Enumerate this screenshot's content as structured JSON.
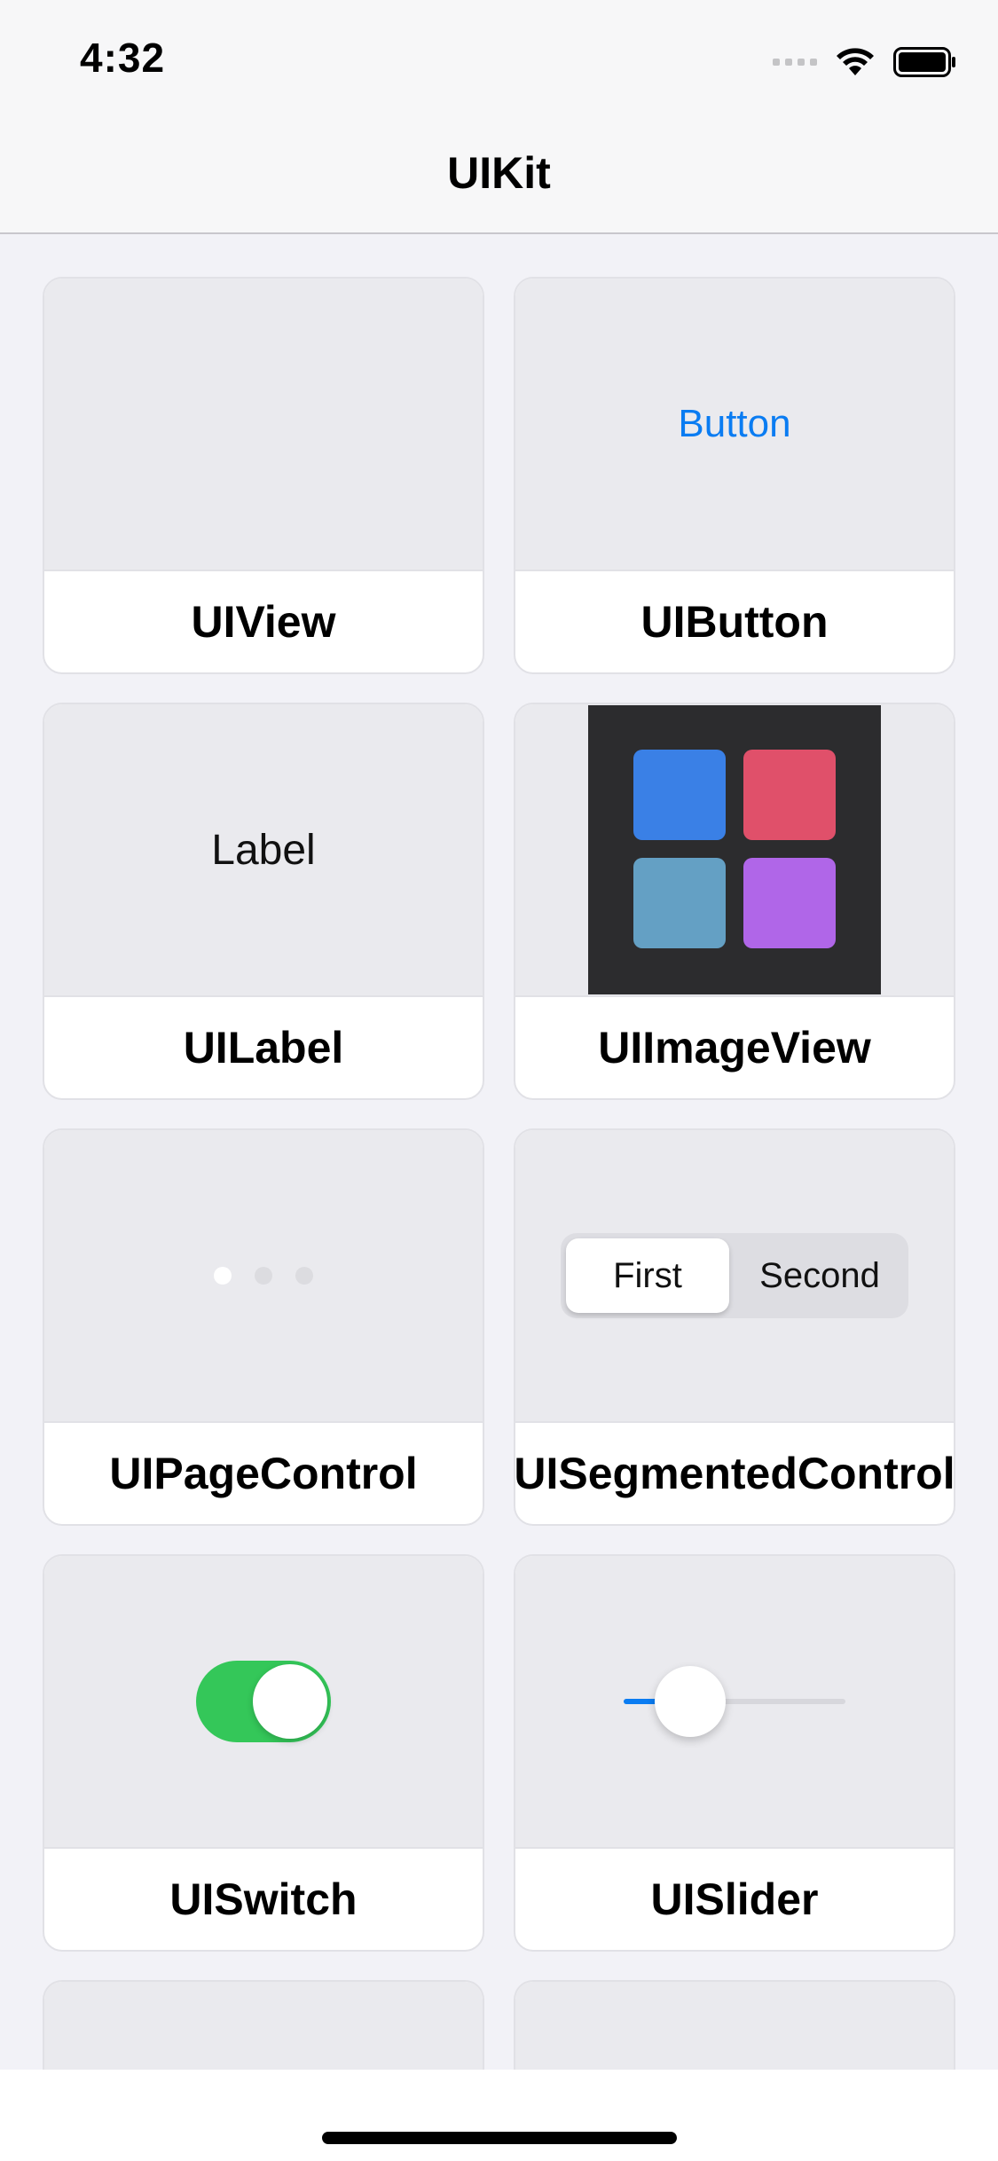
{
  "status_bar": {
    "time": "4:32",
    "icons": [
      "signal-icon",
      "wifi-icon",
      "battery-icon"
    ]
  },
  "nav": {
    "title": "UIKit"
  },
  "cards": [
    {
      "title": "UIView"
    },
    {
      "title": "UIButton",
      "preview_text": "Button"
    },
    {
      "title": "UILabel",
      "preview_text": "Label"
    },
    {
      "title": "UIImageView",
      "tile_colors": [
        "#3a80e6",
        "#e0506a",
        "#64a0c4",
        "#b066e8"
      ]
    },
    {
      "title": "UIPageControl",
      "page_count": 3,
      "current_page": 1
    },
    {
      "title": "UISegmentedControl",
      "segments": [
        "First",
        "Second"
      ],
      "selected_segment": "First"
    },
    {
      "title": "UISwitch",
      "is_on": true
    },
    {
      "title": "UISlider",
      "value": 0.3
    }
  ],
  "colors": {
    "accent": "#0a7cf2",
    "switch_on": "#34c759",
    "background": "#f2f2f7",
    "preview_background": "#eaeaee"
  }
}
